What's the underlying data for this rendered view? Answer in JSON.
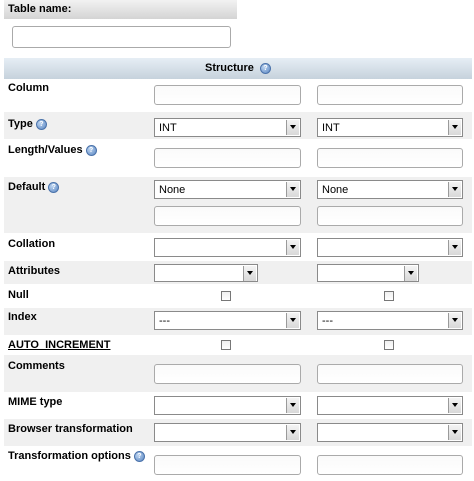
{
  "table_name": {
    "label": "Table name:",
    "value": ""
  },
  "structure": {
    "title": "Structure"
  },
  "fields": {
    "column": "Column",
    "type": "Type",
    "type_values": [
      "INT",
      "INT"
    ],
    "length_values": "Length/Values",
    "default": "Default",
    "default_values": [
      "None",
      "None"
    ],
    "collation": "Collation",
    "attributes": "Attributes",
    "null": "Null",
    "index": "Index",
    "index_values": [
      "---",
      "---"
    ],
    "auto_increment": "AUTO_INCREMENT",
    "comments": "Comments",
    "mime_type": "MIME type",
    "browser_transformation": "Browser transformation",
    "transformation_options": "Transformation options"
  },
  "icons": {
    "help": "help-icon"
  },
  "colors": {
    "structure_header": "#c6d2dc",
    "row_alt": "#f0f0f0"
  }
}
